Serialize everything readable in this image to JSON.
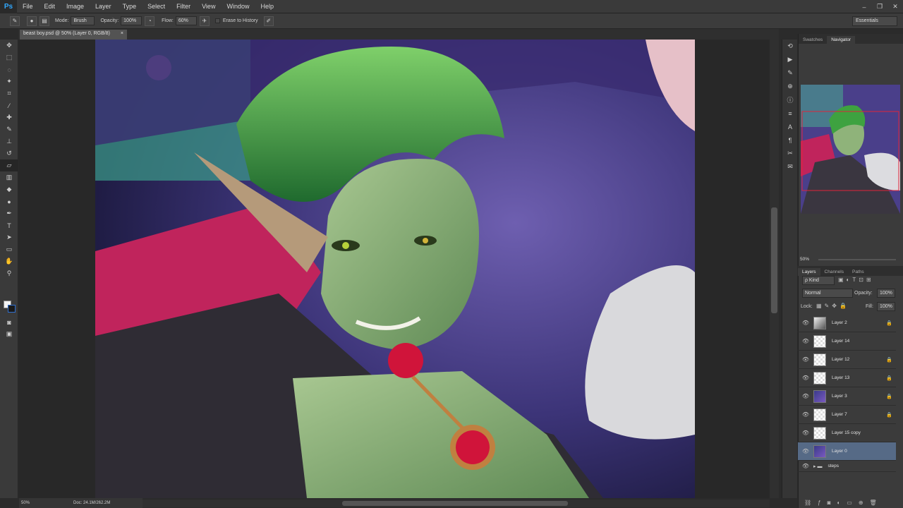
{
  "app": {
    "logo": "Ps"
  },
  "menu": [
    "File",
    "Edit",
    "Image",
    "Layer",
    "Type",
    "Select",
    "Filter",
    "View",
    "Window",
    "Help"
  ],
  "window_controls": [
    "–",
    "❐",
    "✕"
  ],
  "options_bar": {
    "mode_label": "Mode:",
    "mode_value": "Brush",
    "opacity_label": "Opacity:",
    "opacity_value": "100%",
    "flow_label": "Flow:",
    "flow_value": "60%",
    "erase_history_label": "Erase to History"
  },
  "workspace": "Essentials",
  "document": {
    "tab_title": "beast boy.psd @ 50% (Layer 0, RGB/8)",
    "close": "×"
  },
  "status": {
    "zoom": "50%",
    "doc_size": "Doc: 24.1M/262.2M"
  },
  "panels": {
    "top_tabs": [
      "Swatches",
      "Navigator"
    ],
    "navigator_zoom": "50%",
    "layer_tabs": [
      "Layers",
      "Channels",
      "Paths"
    ],
    "kind_label": "ρ Kind",
    "blend_mode": "Normal",
    "opacity_label": "Opacity:",
    "opacity_value": "100%",
    "lock_label": "Lock:",
    "fill_label": "Fill:",
    "fill_value": "100%"
  },
  "layers": [
    {
      "name": "Layer 2",
      "locked": true,
      "thumb": "sketch"
    },
    {
      "name": "Layer 14",
      "locked": false,
      "thumb": "blank"
    },
    {
      "name": "Layer 12",
      "locked": true,
      "thumb": "blank"
    },
    {
      "name": "Layer 13",
      "locked": true,
      "thumb": "blank"
    },
    {
      "name": "Layer 3",
      "locked": true,
      "thumb": "art"
    },
    {
      "name": "Layer 7",
      "locked": true,
      "thumb": "blank"
    },
    {
      "name": "Layer 15 copy",
      "locked": false,
      "thumb": "blank"
    },
    {
      "name": "Layer 0",
      "locked": false,
      "thumb": "art",
      "selected": true
    },
    {
      "name": "steps",
      "locked": false,
      "thumb": "folder"
    }
  ]
}
